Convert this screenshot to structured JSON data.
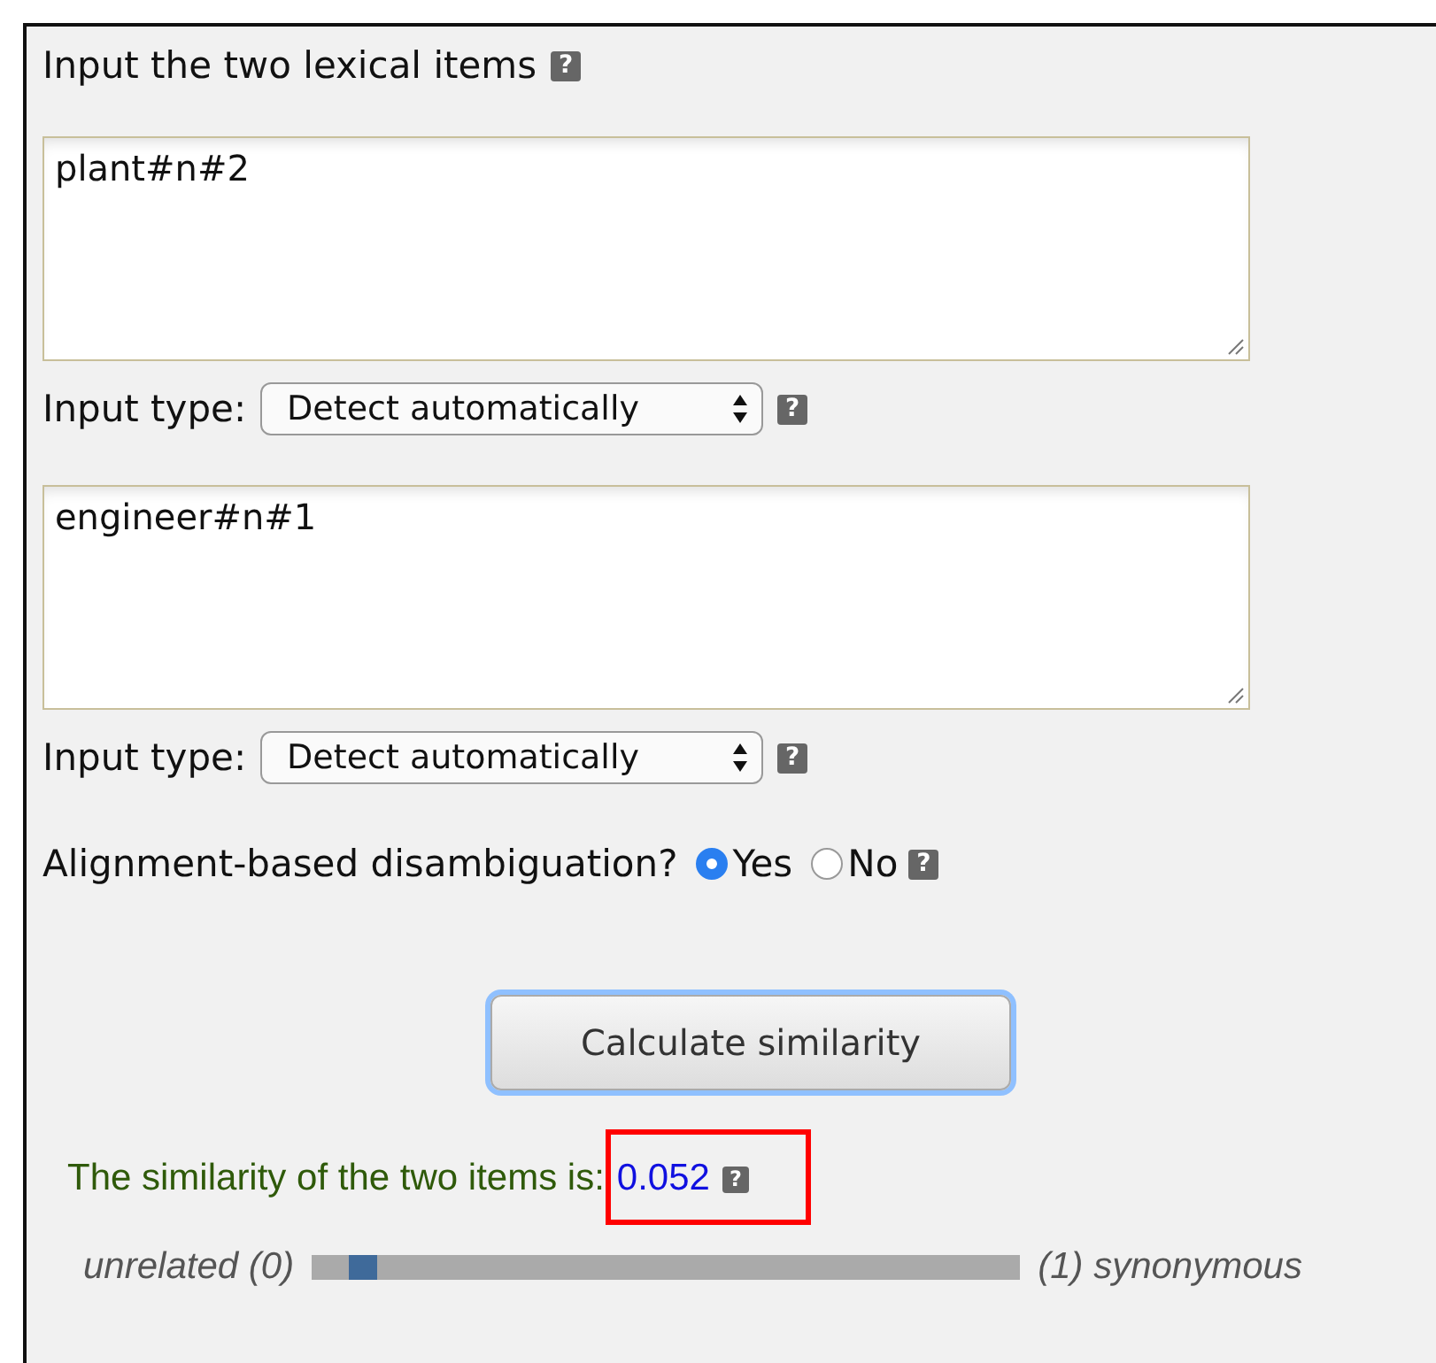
{
  "heading": {
    "text": "Input the two lexical items",
    "help": "?"
  },
  "items": [
    {
      "value": "plant#n#2",
      "type_label": "Input type:",
      "type_value": "Detect automatically",
      "help": "?"
    },
    {
      "value": "engineer#n#1",
      "type_label": "Input type:",
      "type_value": "Detect automatically",
      "help": "?"
    }
  ],
  "alignment": {
    "label": "Alignment-based disambiguation?",
    "options": [
      {
        "label": "Yes",
        "selected": true
      },
      {
        "label": "No",
        "selected": false
      }
    ],
    "help": "?"
  },
  "button": "Calculate similarity",
  "result": {
    "label": "The similarity of the two items is:",
    "value": "0.052",
    "help": "?",
    "highlighted": true
  },
  "scale": {
    "min_label": "unrelated (0)",
    "max_label": "(1) synonymous",
    "level": 0.052
  }
}
